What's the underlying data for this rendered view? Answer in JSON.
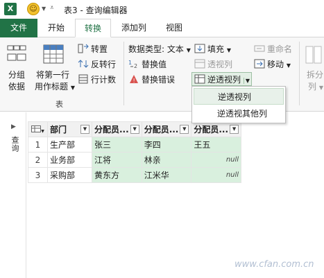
{
  "titlebar": {
    "title": "表3 - 查询编辑器"
  },
  "tabs": [
    {
      "label": "文件"
    },
    {
      "label": "开始"
    },
    {
      "label": "转换"
    },
    {
      "label": "添加列"
    },
    {
      "label": "视图"
    }
  ],
  "ribbon": {
    "table_group": {
      "group_by": "分组\n依据",
      "first_row_header_1": "将第一行",
      "first_row_header_2": "用作标题",
      "transpose": "转置",
      "reverse_rows": "反转行",
      "count_rows": "行计数",
      "label": "表"
    },
    "any_column": {
      "data_type": "数据类型: 文本",
      "replace_values": "替换值",
      "replace_errors": "替换错误",
      "fill": "填充",
      "pivot_column": "透视列",
      "unpivot_columns": "逆透视列",
      "rename": "重命名",
      "move": "移动"
    },
    "split_column_1": "拆分",
    "split_column_2": "列"
  },
  "dropdown": {
    "items": [
      {
        "label": "逆透视列"
      },
      {
        "label": "逆透视其他列"
      }
    ]
  },
  "left_pane": {
    "label": "查询"
  },
  "table": {
    "columns": [
      "部门",
      "分配员...",
      "分配员...",
      "分配员..."
    ],
    "rows": [
      {
        "index": "1",
        "cells": [
          "生产部",
          "张三",
          "李四",
          "王五"
        ]
      },
      {
        "index": "2",
        "cells": [
          "业务部",
          "江将",
          "林亲",
          "null"
        ]
      },
      {
        "index": "3",
        "cells": [
          "采购部",
          "黄东方",
          "江米华",
          "null"
        ]
      }
    ]
  },
  "watermark": "www.cfan.com.cn",
  "colors": {
    "excel_green": "#217346",
    "highlight_green": "#d9f0de"
  },
  "icons": [
    "excel-logo-icon",
    "smiley-icon",
    "table-icon",
    "dropdown-arrow-icon"
  ]
}
